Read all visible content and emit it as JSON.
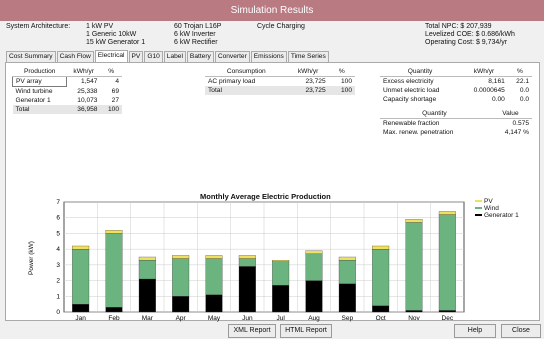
{
  "window": {
    "title": "Simulation Results"
  },
  "system": {
    "label": "System Architecture:",
    "lines": [
      "1 kW PV",
      "1 Generic 10kW",
      "15 kW Generator 1"
    ],
    "col2": [
      "60 Trojan L16P",
      "6 kW Inverter",
      "6 kW Rectifier"
    ],
    "strategy": "Cycle Charging"
  },
  "costs": {
    "npc": "Total NPC: $ 207,939",
    "coe": "Levelized COE: $ 0.686/kWh",
    "op": "Operating Cost: $ 9,734/yr"
  },
  "tabs": [
    "Cost Summary",
    "Cash Flow",
    "Electrical",
    "PV",
    "G10",
    "Label",
    "Battery",
    "Converter",
    "Emissions",
    "Time Series"
  ],
  "production": {
    "headers": [
      "Production",
      "kWh/yr",
      "%"
    ],
    "rows": [
      [
        "PV array",
        "1,547",
        "4"
      ],
      [
        "Wind turbine",
        "25,338",
        "69"
      ],
      [
        "Generator 1",
        "10,073",
        "27"
      ],
      [
        "Total",
        "36,958",
        "100"
      ]
    ]
  },
  "consumption": {
    "headers": [
      "Consumption",
      "kWh/yr",
      "%"
    ],
    "rows": [
      [
        "AC primary load",
        "23,725",
        "100"
      ],
      [
        "Total",
        "23,725",
        "100"
      ]
    ]
  },
  "quantity": {
    "headers": [
      "Quantity",
      "kWh/yr",
      "%"
    ],
    "rows": [
      [
        "Excess electricity",
        "8,161",
        "22.1"
      ],
      [
        "Unmet electric load",
        "0.0000645",
        "0.0"
      ],
      [
        "Capacity shortage",
        "0.00",
        "0.0"
      ]
    ]
  },
  "renew": {
    "headers": [
      "Quantity",
      "Value"
    ],
    "rows": [
      [
        "Renewable fraction",
        "0.575"
      ],
      [
        "Max. renew. penetration",
        "4,147 %"
      ]
    ]
  },
  "chart_data": {
    "type": "bar",
    "title": "Monthly Average Electric Production",
    "ylabel": "Power (kW)",
    "ylim": [
      0,
      7
    ],
    "yticks": [
      "0",
      "1",
      "2",
      "3",
      "4",
      "5",
      "6",
      "7"
    ],
    "categories": [
      "Jan",
      "Feb",
      "Mar",
      "Apr",
      "May",
      "Jun",
      "Jul",
      "Aug",
      "Sep",
      "Oct",
      "Nov",
      "Dec"
    ],
    "stacked": true,
    "legend_position": "top-right",
    "series": [
      {
        "name": "Generator 1",
        "color": "#000000",
        "values": [
          0.5,
          0.3,
          2.1,
          1.0,
          1.1,
          2.9,
          1.7,
          2.0,
          1.8,
          0.4,
          0.1,
          0.1
        ]
      },
      {
        "name": "Wind",
        "color": "#6cb47f",
        "values": [
          3.5,
          4.7,
          1.2,
          2.4,
          2.3,
          0.5,
          1.5,
          1.7,
          1.5,
          3.6,
          5.6,
          6.1
        ]
      },
      {
        "name": "PV",
        "color": "#f0e060",
        "values": [
          0.2,
          0.2,
          0.2,
          0.2,
          0.2,
          0.2,
          0.1,
          0.2,
          0.2,
          0.2,
          0.2,
          0.2
        ]
      }
    ]
  },
  "buttons": {
    "xml": "XML Report",
    "html": "HTML Report",
    "help": "Help",
    "close": "Close"
  }
}
